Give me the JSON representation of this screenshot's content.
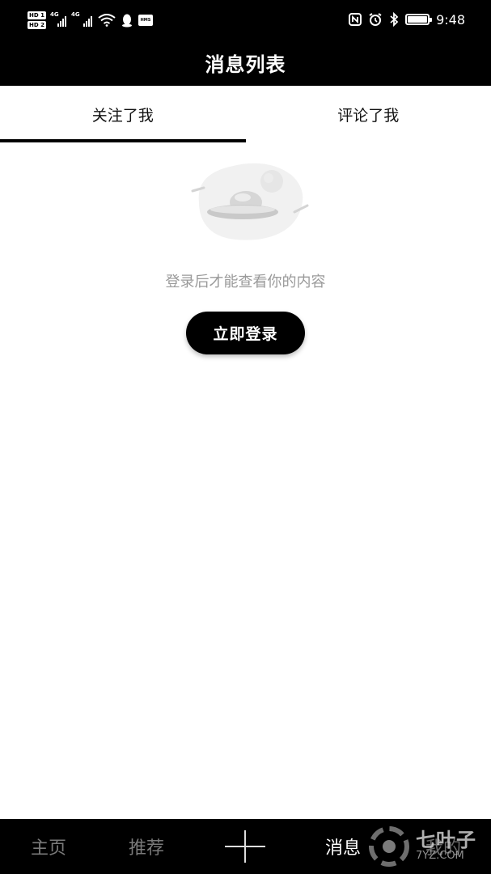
{
  "status_bar": {
    "time": "9:48",
    "sim_badges": [
      "HD 1",
      "HD 2"
    ],
    "network": [
      "4G",
      "4G"
    ],
    "icons": [
      "wifi-icon",
      "qq-icon",
      "hms-icon",
      "nfc-icon",
      "alarm-icon",
      "bluetooth-icon",
      "battery-icon"
    ],
    "hms_label": "HMS"
  },
  "header": {
    "title": "消息列表"
  },
  "tabs": [
    {
      "label": "关注了我",
      "active": true
    },
    {
      "label": "评论了我",
      "active": false
    }
  ],
  "empty_state": {
    "illustration": "ufo-planet-illustration",
    "message": "登录后才能查看你的内容",
    "button_label": "立即登录"
  },
  "bottom_nav": {
    "items": [
      {
        "label": "主页",
        "active": false
      },
      {
        "label": "推荐",
        "active": false
      },
      {
        "label": "",
        "icon": "plus-icon",
        "active": false
      },
      {
        "label": "消息",
        "active": true
      },
      {
        "label": "我的",
        "active": false
      }
    ]
  },
  "watermark": {
    "brand": "七叶子",
    "url": "7YZ.COM"
  },
  "colors": {
    "bar_background": "#000000",
    "page_background": "#ffffff",
    "muted_text": "#9a9a9a",
    "nav_inactive": "#7a7a7a",
    "nav_active": "#ffffff"
  }
}
